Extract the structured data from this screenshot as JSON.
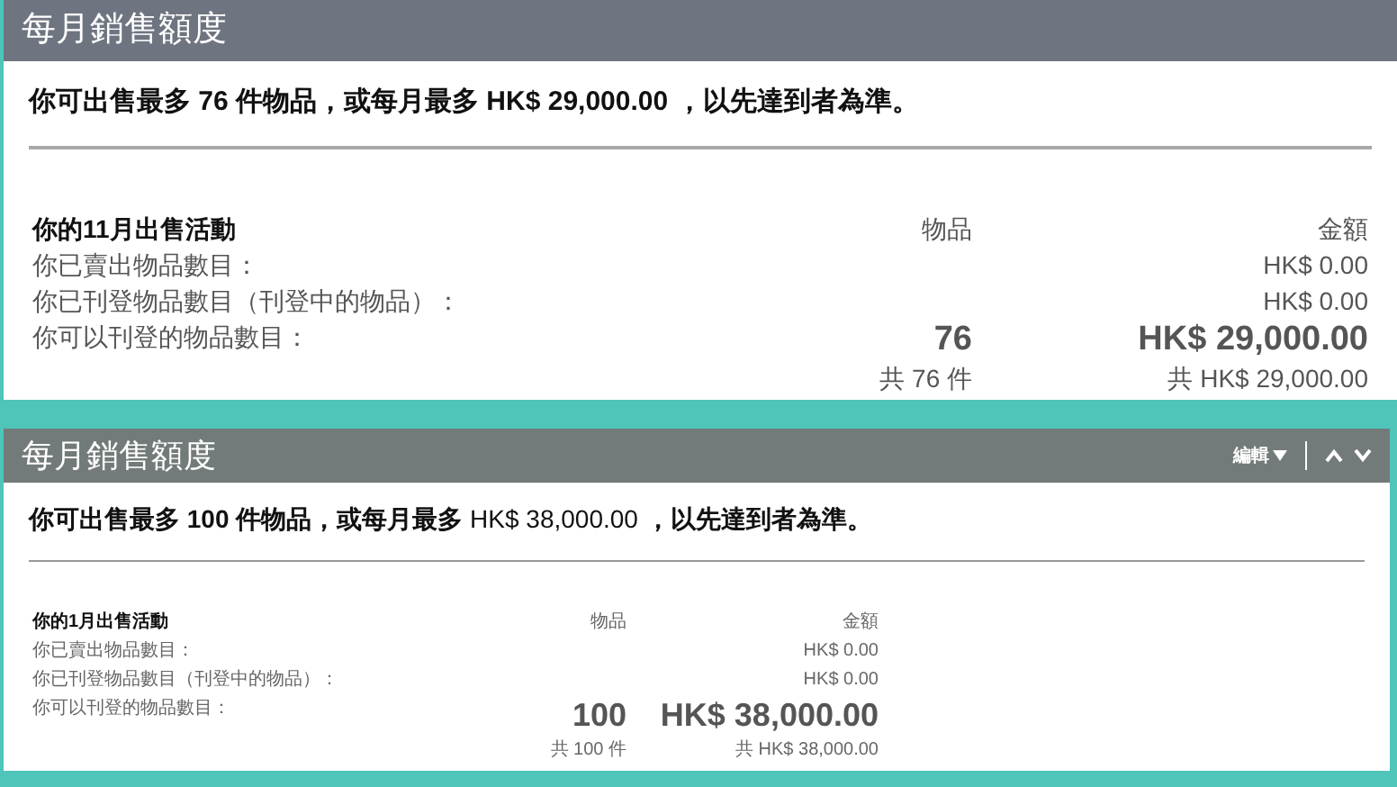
{
  "panels": [
    {
      "kind": "large",
      "title": "每月銷售額度",
      "summary": "你可出售最多 76 件物品，或每月最多 HK$ 29,000.00 ，以先達到者為準。",
      "activity": {
        "heading": "你的11月出售活動",
        "columns": [
          "物品",
          "金額"
        ],
        "rows": [
          {
            "kind": "normal",
            "label": "你已賣出物品數目：",
            "amount": "HK$ 0.00"
          },
          {
            "kind": "normal",
            "label": "你已刊登物品數目（刊登中的物品）：",
            "amount": "HK$ 0.00"
          },
          {
            "kind": "emphasis",
            "label": "你可以刊登的物品數目：",
            "items": "76",
            "amount": "HK$ 29,000.00"
          },
          {
            "kind": "total",
            "items": "共 76 件",
            "amount": "共 HK$ 29,000.00"
          }
        ]
      }
    },
    {
      "kind": "compact",
      "title": "每月銷售額度",
      "toolbar": {
        "edit": "編輯"
      },
      "summary": "**你可出售最多 100 件物品，或每月最多** HK$ 38,000.00 **，以先達到者為準。**",
      "activity": {
        "heading": "你的1月出售活動",
        "columns": [
          "物品",
          "金額"
        ],
        "rows": [
          {
            "kind": "normal",
            "label": "你已賣出物品數目：",
            "amount": "HK$ 0.00"
          },
          {
            "kind": "normal",
            "label": "你已刊登物品數目（刊登中的物品）：",
            "amount": "HK$ 0.00"
          },
          {
            "kind": "emphasis",
            "label": "你可以刊登的物品數目：",
            "items": "100",
            "amount": "HK$ 38,000.00"
          },
          {
            "kind": "total",
            "items": "共 100 件",
            "amount": "共 HK$ 38,000.00"
          }
        ]
      }
    }
  ]
}
